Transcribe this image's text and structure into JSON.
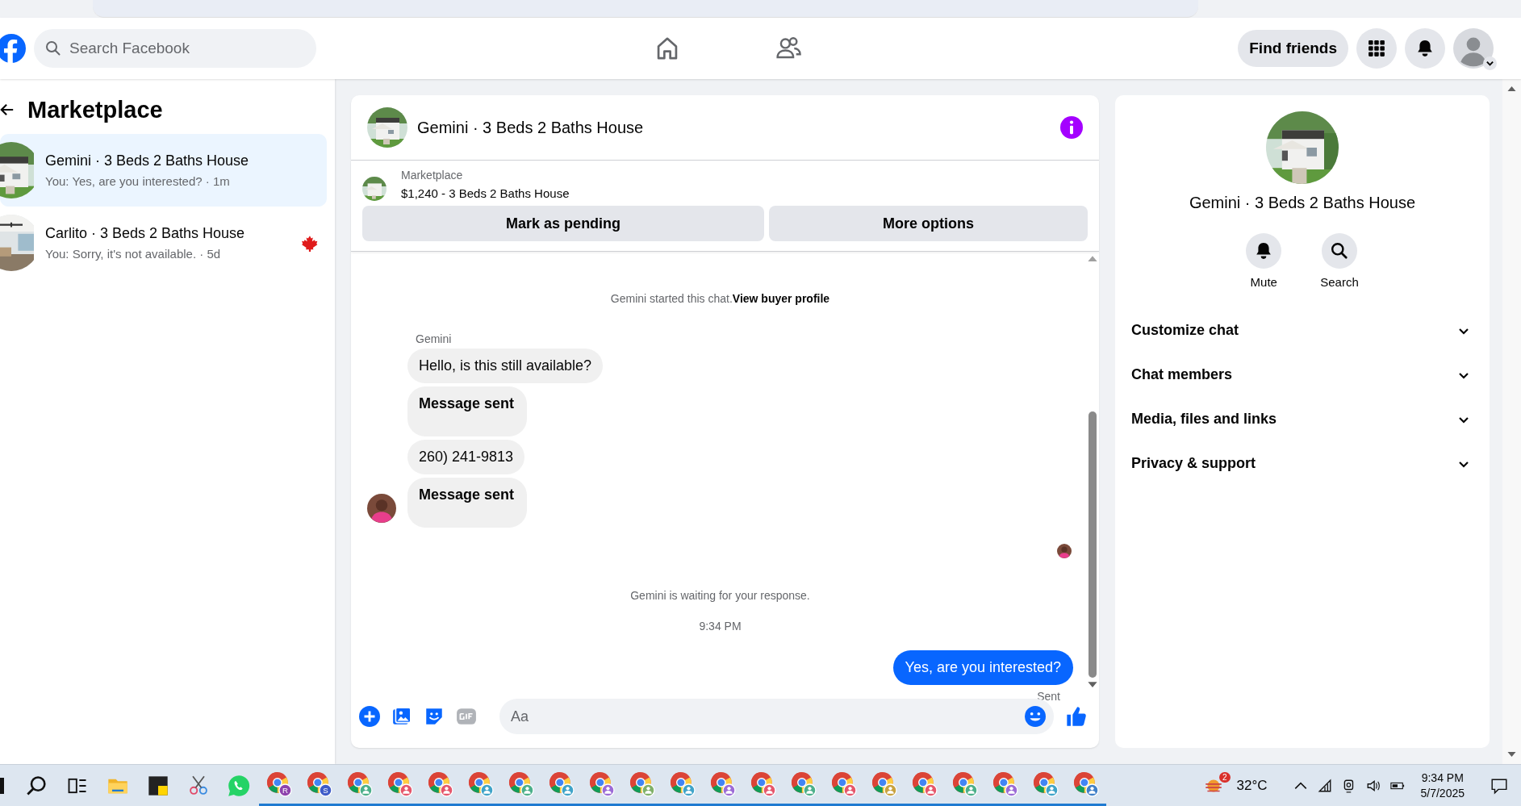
{
  "header": {
    "search": {
      "placeholder": "Search Facebook"
    },
    "nav": [
      {
        "kind": "home",
        "selected": false
      },
      {
        "kind": "friends",
        "selected": false
      }
    ],
    "find_friends": "Find friends"
  },
  "sidebar": {
    "title": "Marketplace",
    "conversations": [
      {
        "title": "Gemini · 3 Beds 2 Baths House",
        "preview": "You: Yes, are you interested? · 1m",
        "selected": true,
        "has_badge": false
      },
      {
        "title": "Carlito · 3 Beds 2 Baths House",
        "preview": "You: Sorry, it's not available. · 5d",
        "selected": false,
        "has_badge": true
      }
    ]
  },
  "chat": {
    "title": "Gemini · 3 Beds 2 Baths House",
    "listing": {
      "label": "Marketplace",
      "price_title": "$1,240 - 3 Beds 2 Baths House"
    },
    "buttons": [
      "Mark as pending",
      "More options"
    ],
    "messages": [
      {
        "kind": "system",
        "text": "Gemini started this chat.",
        "link": "View buyer profile"
      },
      {
        "kind": "sender",
        "text": "Gemini"
      },
      {
        "kind": "in",
        "text": "Hello, is this still available?",
        "bold": false
      },
      {
        "kind": "in",
        "text": "Message sent",
        "bold": true
      },
      {
        "kind": "in",
        "text": "260) 241-9813",
        "bold": false
      },
      {
        "kind": "in",
        "text": "Message sent",
        "bold": true,
        "avatar": true
      },
      {
        "kind": "seen"
      },
      {
        "kind": "system",
        "text": "Gemini is waiting for your response."
      },
      {
        "kind": "time",
        "text": "9:34 PM"
      },
      {
        "kind": "out",
        "text": "Yes, are you interested?"
      },
      {
        "kind": "status",
        "text": "Sent"
      }
    ],
    "composer": {
      "placeholder": "Aa"
    }
  },
  "info": {
    "title": "Gemini · 3 Beds 2 Baths House",
    "actions": [
      {
        "kind": "bell",
        "label": "Mute"
      },
      {
        "kind": "search",
        "label": "Search"
      }
    ],
    "sections": [
      {
        "label": "Customize chat",
        "expanded": false
      },
      {
        "label": "Chat members",
        "expanded": false
      },
      {
        "label": "Media, files and links",
        "expanded": false
      },
      {
        "label": "Privacy & support",
        "expanded": false
      }
    ]
  },
  "taskbar": {
    "apps": [
      {
        "kind": "search"
      },
      {
        "kind": "taskview"
      },
      {
        "kind": "folder"
      },
      {
        "kind": "notes"
      },
      {
        "kind": "snip"
      },
      {
        "kind": "whatsapp"
      },
      {
        "kind": "chrome",
        "color": "#8e44ad",
        "letter": "R"
      },
      {
        "kind": "chrome",
        "color": "#3f5cc8",
        "letter": "S"
      },
      {
        "kind": "chrome",
        "color": "#4caf8a"
      },
      {
        "kind": "chrome",
        "color": "#e5566b"
      },
      {
        "kind": "chrome",
        "color": "#e5566b"
      },
      {
        "kind": "chrome",
        "color": "#3fa3c8"
      },
      {
        "kind": "chrome",
        "color": "#4caf8a"
      },
      {
        "kind": "chrome",
        "color": "#3fa3c8"
      },
      {
        "kind": "chrome",
        "color": "#9b6bd6"
      },
      {
        "kind": "chrome",
        "color": "#7fb069"
      },
      {
        "kind": "chrome",
        "color": "#3fa3c8"
      },
      {
        "kind": "chrome",
        "color": "#9b6bd6"
      },
      {
        "kind": "chrome",
        "color": "#e5566b"
      },
      {
        "kind": "chrome",
        "color": "#4caf8a"
      },
      {
        "kind": "chrome",
        "color": "#e5566b"
      },
      {
        "kind": "chrome",
        "color": "#c8a23f"
      },
      {
        "kind": "chrome",
        "color": "#e5566b"
      },
      {
        "kind": "chrome",
        "color": "#4caf8a"
      },
      {
        "kind": "chrome",
        "color": "#9b6bd6"
      },
      {
        "kind": "chrome",
        "color": "#3fa3c8"
      },
      {
        "kind": "chrome",
        "color": "#3f7fc8"
      }
    ],
    "weather_badge": "2",
    "temperature": "32°C",
    "time": "9:34 PM",
    "date": "5/7/2025"
  }
}
